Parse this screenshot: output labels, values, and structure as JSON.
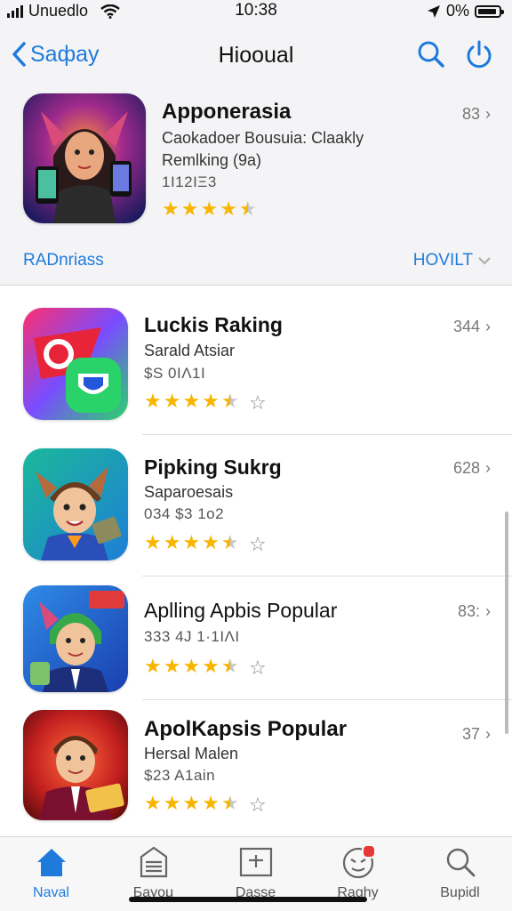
{
  "status_bar": {
    "carrier": "Unuedlo",
    "time": "10:38",
    "battery": "0%"
  },
  "navbar": {
    "back_label": "Saфay",
    "title": "Hiooual"
  },
  "featured": {
    "title": "Apponerasia",
    "subtitle_line1": "Caokadoer Bousuia: Claakly",
    "subtitle_line2": "Remlking (9a)",
    "meta": "1Ι12ΙΞ3",
    "rank": "83",
    "rating": 4.5,
    "link_left": "RADnriass",
    "link_right": "HOVILT"
  },
  "apps": [
    {
      "title": "Luckis Raking",
      "subtitle": "Sarald Atsiar",
      "meta": "$S 0ΙΛ1Ι",
      "rank": "344",
      "rating": 4.5
    },
    {
      "title": "Pipking Sukrg",
      "subtitle": "Saparoesais",
      "meta": "034 $3 1o2",
      "rank": "628",
      "rating": 4.5
    },
    {
      "title": "Aplling Apbis Popular",
      "subtitle": "",
      "meta": "333 4J 1·1ΙΛΙ",
      "rank": "83:",
      "rating": 4.5
    },
    {
      "title": "ApolKapsis Popular",
      "subtitle": "Hersal Malen",
      "meta": "$23 A1ain",
      "rank": "37",
      "rating": 4.5
    }
  ],
  "tabs": [
    {
      "label": "Naval",
      "icon": "home-icon",
      "active": true
    },
    {
      "label": "Баyoμ",
      "icon": "list-icon",
      "active": false
    },
    {
      "label": "Dasse",
      "icon": "grid-icon",
      "active": false
    },
    {
      "label": "Raghy",
      "icon": "smiley-icon",
      "active": false
    },
    {
      "label": "Bupidl",
      "icon": "search-icon",
      "active": false
    }
  ],
  "colors": {
    "accent": "#1e7bdc",
    "star": "#f7b500",
    "badge": "#e53935"
  }
}
